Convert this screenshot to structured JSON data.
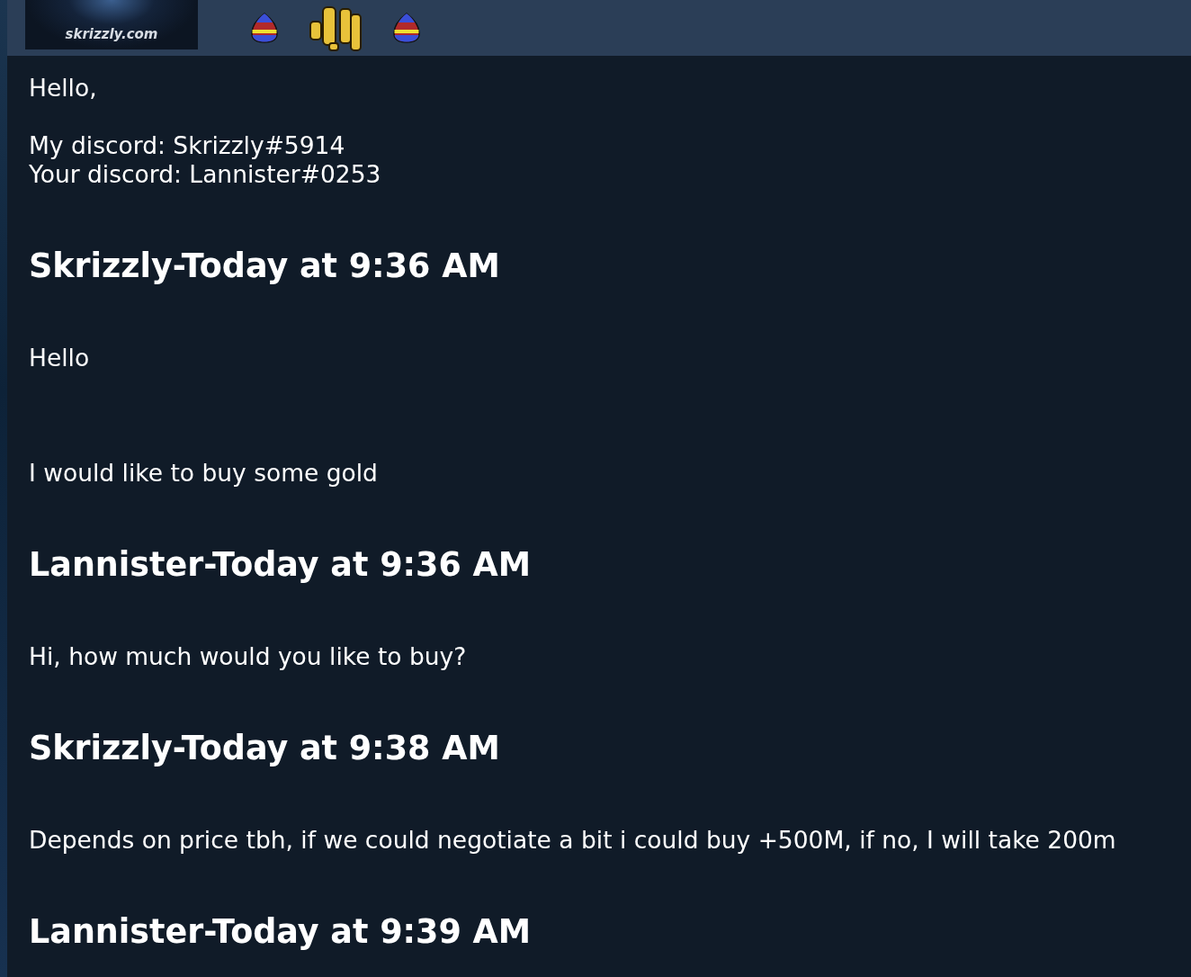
{
  "header": {
    "logo_text": "skrizzly.com"
  },
  "intro": [
    "Hello,",
    "My discord: Skrizzly#5914",
    "Your discord: Lannister#0253"
  ],
  "messages": [
    {
      "kind": "author",
      "text": "Skrizzly-Today at 9:36 AM"
    },
    {
      "kind": "message",
      "text": "Hello"
    },
    {
      "kind": "message",
      "text": "I would like to buy some gold"
    },
    {
      "kind": "author",
      "text": "Lannister-Today at 9:36 AM"
    },
    {
      "kind": "message",
      "text": "Hi, how much would you like to buy?"
    },
    {
      "kind": "author",
      "text": "Skrizzly-Today at 9:38 AM"
    },
    {
      "kind": "message",
      "text": "Depends on price tbh, if we could negotiate a bit i could buy +500M, if no, I will take 200m"
    },
    {
      "kind": "author",
      "text": "Lannister-Today at 9:39 AM"
    }
  ]
}
